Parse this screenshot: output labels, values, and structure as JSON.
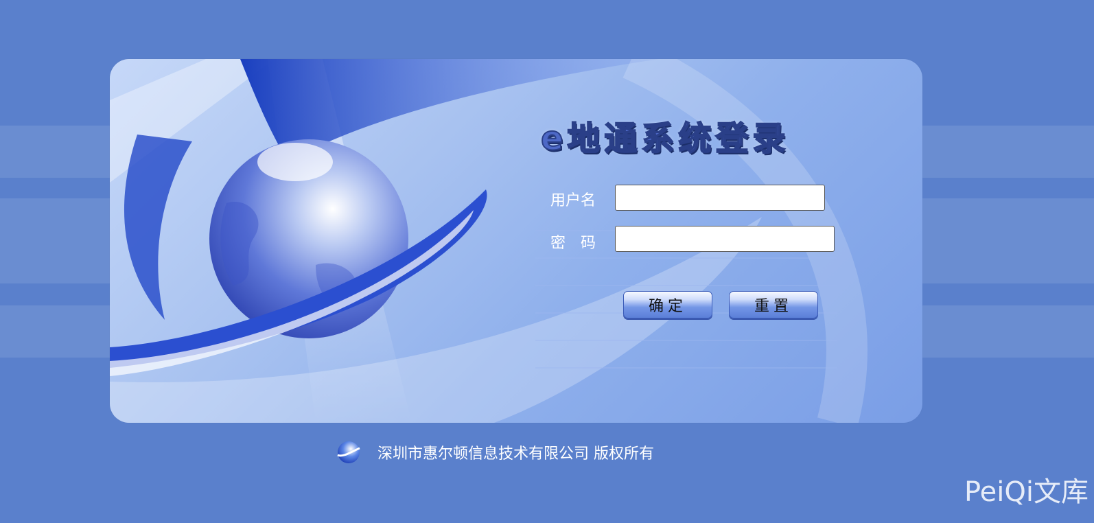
{
  "login": {
    "title": "e地通系统登录",
    "username_label": "用户名",
    "username_value": "",
    "password_label": "密　码",
    "password_value": "",
    "submit_label": "确定",
    "reset_label": "重置"
  },
  "footer": {
    "copyright": "深圳市惠尔顿信息技术有限公司 版权所有",
    "logo_icon": "company-logo-icon"
  },
  "watermark": {
    "text": "PeiQi文库"
  },
  "colors": {
    "page_background": "#5a80cc",
    "card_light": "#c6d8f8",
    "card_dark": "#7a9ee6",
    "button_blue": "#5b7fd8"
  }
}
